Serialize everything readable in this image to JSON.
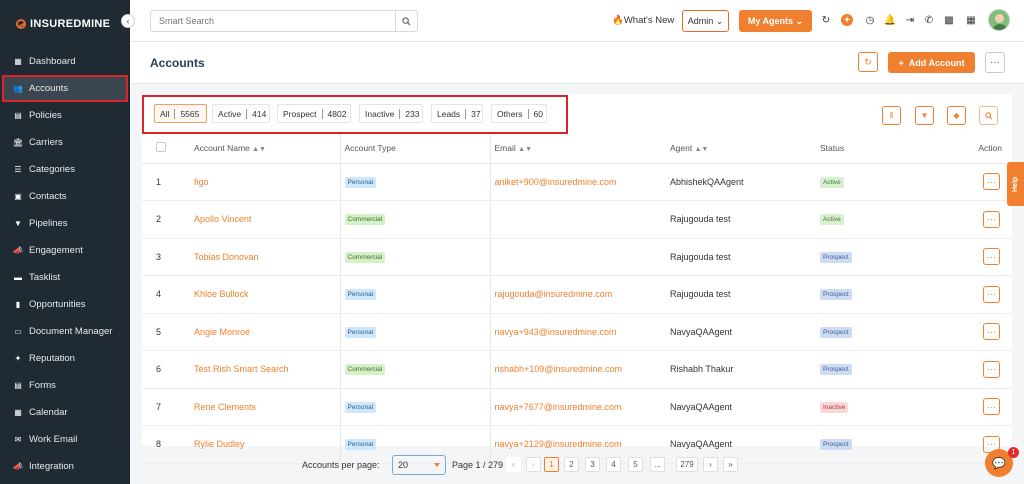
{
  "brand": "INSUREDMINE",
  "sidebar": {
    "items": [
      {
        "label": "Dashboard",
        "icon": "dashboard-icon",
        "glyph": "▦"
      },
      {
        "label": "Accounts",
        "icon": "accounts-icon",
        "glyph": "👥",
        "active": true
      },
      {
        "label": "Policies",
        "icon": "policies-icon",
        "glyph": "▤"
      },
      {
        "label": "Carriers",
        "icon": "carriers-icon",
        "glyph": "🏛"
      },
      {
        "label": "Categories",
        "icon": "categories-icon",
        "glyph": "☰"
      },
      {
        "label": "Contacts",
        "icon": "contacts-icon",
        "glyph": "▣"
      },
      {
        "label": "Pipelines",
        "icon": "pipelines-icon",
        "glyph": "▼"
      },
      {
        "label": "Engagement",
        "icon": "engagement-icon",
        "glyph": "📣"
      },
      {
        "label": "Tasklist",
        "icon": "tasklist-icon",
        "glyph": "▬"
      },
      {
        "label": "Opportunities",
        "icon": "opportunities-icon",
        "glyph": "▮"
      },
      {
        "label": "Document Manager",
        "icon": "folder-icon",
        "glyph": "▭"
      },
      {
        "label": "Reputation",
        "icon": "reputation-icon",
        "glyph": "✦"
      },
      {
        "label": "Forms",
        "icon": "forms-icon",
        "glyph": "▤"
      },
      {
        "label": "Calendar",
        "icon": "calendar-icon",
        "glyph": "▦"
      },
      {
        "label": "Work Email",
        "icon": "email-icon",
        "glyph": "✉"
      },
      {
        "label": "Integration",
        "icon": "integration-icon",
        "glyph": "📣"
      }
    ]
  },
  "topbar": {
    "search_placeholder": "Smart Search",
    "whats_new": "What's New",
    "admin": "Admin",
    "my_agents": "My Agents"
  },
  "page": {
    "title": "Accounts",
    "add_account": "Add Account"
  },
  "filters": [
    {
      "label": "All",
      "count": "5565",
      "active": true
    },
    {
      "label": "Active",
      "count": "414"
    },
    {
      "label": "Prospect",
      "count": "4802"
    },
    {
      "label": "Inactive",
      "count": "233"
    },
    {
      "label": "Leads",
      "count": "37"
    },
    {
      "label": "Others",
      "count": "60"
    }
  ],
  "table": {
    "headers": [
      "Account Name",
      "Account Type",
      "Email",
      "Agent",
      "Status",
      "Action"
    ],
    "rows": [
      {
        "n": "1",
        "name": "figo",
        "type": "Personal",
        "email": "aniket+900@insuredmine.com",
        "agent": "AbhishekQAAgent",
        "status": "Active"
      },
      {
        "n": "2",
        "name": "Apollo Vincent",
        "type": "Commercial",
        "email": "",
        "agent": "Rajugouda test",
        "status": "Active"
      },
      {
        "n": "3",
        "name": "Tobias Donovan",
        "type": "Commercial",
        "email": "",
        "agent": "Rajugouda test",
        "status": "Prospect"
      },
      {
        "n": "4",
        "name": "Khloe Bullock",
        "type": "Personal",
        "email": "rajugouda@insuredmine.com",
        "agent": "Rajugouda test",
        "status": "Prospect"
      },
      {
        "n": "5",
        "name": "Angie Monroe",
        "type": "Personal",
        "email": "navya+943@insuredmine.com",
        "agent": "NavyaQAAgent",
        "status": "Prospect"
      },
      {
        "n": "6",
        "name": "Test Rish Smart Search",
        "type": "Commercial",
        "email": "rishabh+109@insuredmine.com",
        "agent": "Rishabh Thakur",
        "status": "Prospect"
      },
      {
        "n": "7",
        "name": "Rene Clements",
        "type": "Personal",
        "email": "navya+7677@insuredmine.com",
        "agent": "NavyaQAAgent",
        "status": "Inactive"
      },
      {
        "n": "8",
        "name": "Rylie Dudley",
        "type": "Personal",
        "email": "navya+2129@insuredmine.com",
        "agent": "NavyaQAAgent",
        "status": "Prospect"
      }
    ]
  },
  "pagination": {
    "per_page_label": "Accounts per page:",
    "per_page": "20",
    "page_info": "Page 1 / 279",
    "pages": [
      "1",
      "2",
      "3",
      "4",
      "5",
      "...",
      "279"
    ]
  },
  "help": "Help",
  "chat_badge": "1",
  "colors": {
    "accent": "#f0802f",
    "sidebar": "#1f2a33",
    "highlight": "#d9242b"
  }
}
